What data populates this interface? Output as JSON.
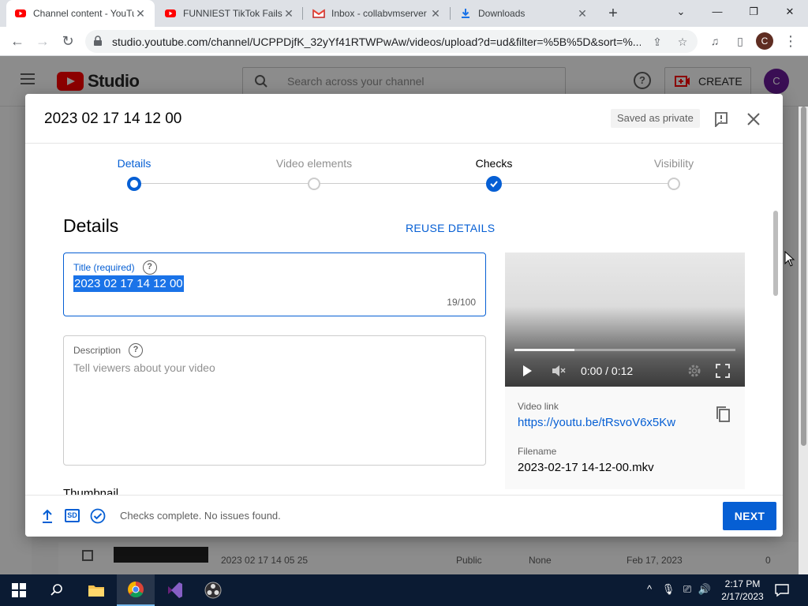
{
  "browser": {
    "tabs": [
      {
        "title": "Channel content - YouTube",
        "active": true
      },
      {
        "title": "FUNNIEST TikTok Fails",
        "active": false
      },
      {
        "title": "Inbox - collabvmserver",
        "active": false
      },
      {
        "title": "Downloads",
        "active": false
      }
    ],
    "url": "studio.youtube.com/channel/UCPPDjfK_32yYf41RTWPwAw/videos/upload?d=ud&filter=%5B%5D&sort=%...",
    "profile_initial": "C"
  },
  "studio": {
    "logo_text": "Studio",
    "search_placeholder": "Search across your channel",
    "help_glyph": "?",
    "create_label": "CREATE",
    "avatar_initial": "C",
    "bg_row": {
      "title": "2023 02 17 14 05 25",
      "visibility": "Public",
      "restrictions": "None",
      "date": "Feb 17, 2023",
      "views": "0"
    }
  },
  "dialog": {
    "title": "2023 02 17 14 12 00",
    "saved_status": "Saved as private",
    "steps": [
      {
        "label": "Details",
        "state": "current"
      },
      {
        "label": "Video elements",
        "state": "pending"
      },
      {
        "label": "Checks",
        "state": "done"
      },
      {
        "label": "Visibility",
        "state": "pending"
      }
    ],
    "section_heading": "Details",
    "reuse_label": "REUSE DETAILS",
    "title_field": {
      "label": "Title (required)",
      "value": "2023 02 17 14 12 00",
      "counter": "19/100"
    },
    "help_glyph": "?",
    "description_field": {
      "label": "Description",
      "placeholder": "Tell viewers about your video"
    },
    "thumbnail_heading": "Thumbnail",
    "preview": {
      "time": "0:00 / 0:12",
      "progress_fraction": 0.27,
      "video_link_label": "Video link",
      "video_link": "https://youtu.be/tRsvoV6x5Kw",
      "filename_label": "Filename",
      "filename": "2023-02-17 14-12-00.mkv"
    },
    "footer": {
      "sd_badge": "SD",
      "status": "Checks complete. No issues found.",
      "next_label": "NEXT"
    }
  },
  "taskbar": {
    "time": "2:17 PM",
    "date": "2/17/2023"
  },
  "colors": {
    "accent": "#065fd4",
    "youtube_red": "#ff0000",
    "taskbar": "#0b1b33"
  }
}
